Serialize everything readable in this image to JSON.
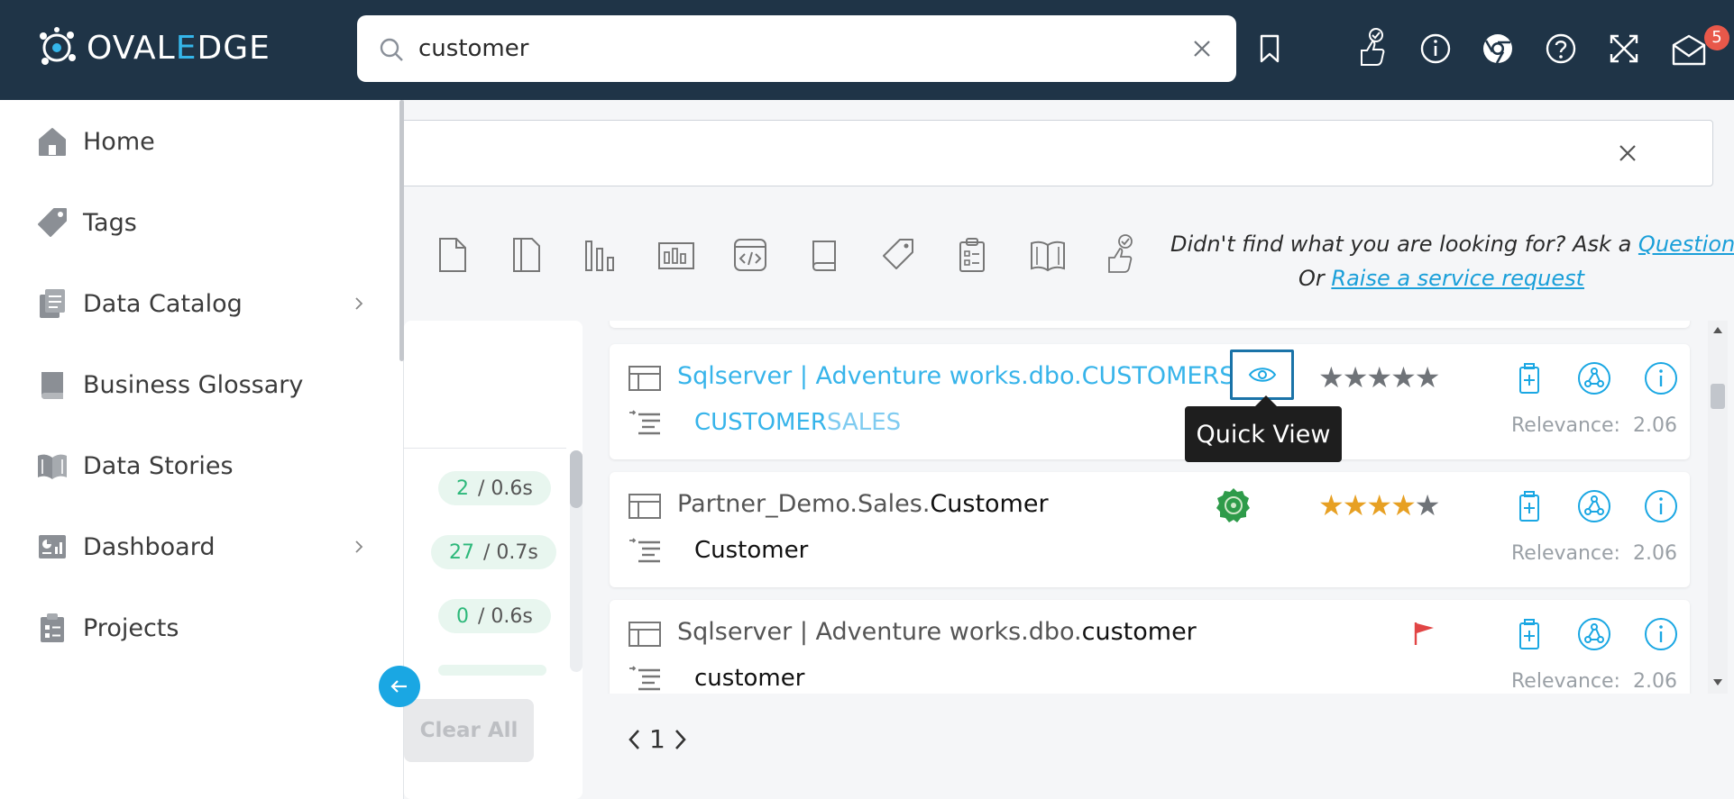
{
  "header": {
    "logo": {
      "part1": "OVAL",
      "part2": "E",
      "part3": "DGE"
    },
    "search": {
      "value": "customer",
      "placeholder": ""
    },
    "notification_count": "5"
  },
  "sidebar": {
    "items": [
      {
        "label": "Home",
        "icon": "home-icon",
        "has_submenu": false
      },
      {
        "label": "Tags",
        "icon": "tag-icon",
        "has_submenu": false
      },
      {
        "label": "Data Catalog",
        "icon": "data-catalog-icon",
        "has_submenu": true
      },
      {
        "label": "Business Glossary",
        "icon": "book-icon",
        "has_submenu": false
      },
      {
        "label": "Data Stories",
        "icon": "open-book-icon",
        "has_submenu": false
      },
      {
        "label": "Dashboard",
        "icon": "dashboard-icon",
        "has_submenu": true
      },
      {
        "label": "Projects",
        "icon": "clipboard-icon",
        "has_submenu": false
      }
    ]
  },
  "ask": {
    "line1_prefix": "Didn't find what you are looking for? Ask a ",
    "question_link": "Question",
    "line2_prefix": "Or ",
    "service_link": "Raise a service request"
  },
  "facets": {
    "pills": [
      {
        "count": "2",
        "time": "/ 0.6s"
      },
      {
        "count": "27",
        "time": "/ 0.7s"
      },
      {
        "count": "0",
        "time": "/ 0.6s"
      }
    ],
    "clear_all": "Clear All"
  },
  "results": [
    {
      "title_prefix": "Sqlserver | Adventure works.dbo.",
      "title_match": "CUSTOMERS...",
      "sub_match": "CUSTOMER",
      "sub_rest": "SALES",
      "rating": 0,
      "relevance_label": "Relevance:",
      "relevance": "2.06"
    },
    {
      "title_prefix": "Partner_Demo.Sales.",
      "title_match": "Customer",
      "sub_match": "Customer",
      "sub_rest": "",
      "rating": 4,
      "relevance_label": "Relevance:",
      "relevance": "2.06"
    },
    {
      "title_prefix": "Sqlserver | Adventure works.dbo.",
      "title_match": "customer",
      "sub_match": "customer",
      "sub_rest": "",
      "rating": null,
      "relevance_label": "Relevance:",
      "relevance": "2.06"
    }
  ],
  "tooltip": {
    "quick_view": "Quick View"
  },
  "pager": {
    "page": "1"
  },
  "colors": {
    "header_bg": "#1f3447",
    "accent": "#1aa7e3",
    "link": "#37b4ea",
    "star": "#e7a023"
  }
}
